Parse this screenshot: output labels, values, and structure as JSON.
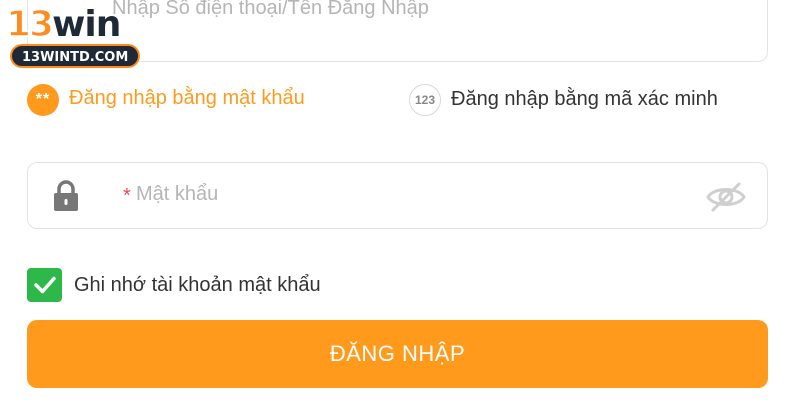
{
  "logo": {
    "num": "13",
    "word": "win",
    "domain": "13WINTD.COM"
  },
  "username": {
    "placeholder": "Nhập Số điện thoại/Tên Đăng Nhập"
  },
  "login_methods": [
    {
      "badge": "**",
      "label": "Đăng nhập bằng mật khẩu",
      "active": true
    },
    {
      "badge": "123",
      "label": "Đăng nhập bằng mã xác minh",
      "active": false
    }
  ],
  "password": {
    "required_mark": "*",
    "placeholder": "Mật khẩu",
    "icon": "lock-icon",
    "toggle_icon": "eye-off-icon"
  },
  "remember": {
    "label": "Ghi nhớ tài khoản mật khẩu",
    "checked": true
  },
  "login_button": {
    "label": "ĐĂNG NHẬP"
  },
  "colors": {
    "accent": "#ff9a1c",
    "check": "#2fb84a",
    "required": "#e54b4b",
    "placeholder": "#b5b5b5"
  }
}
